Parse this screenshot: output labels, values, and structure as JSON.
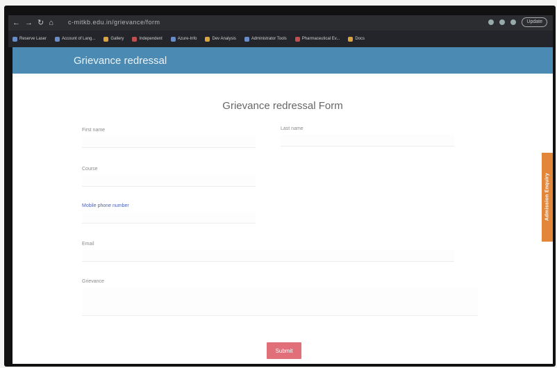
{
  "browser": {
    "url": "c-mitkb.edu.in/grievance/form",
    "profile_label": "Update",
    "bookmarks": [
      {
        "label": "Reserve Laser"
      },
      {
        "label": "Account of Lang..."
      },
      {
        "label": "Gallery"
      },
      {
        "label": "Independent"
      },
      {
        "label": "Azure-Info"
      },
      {
        "label": "Dev Analysis"
      },
      {
        "label": "Administrator Tools"
      },
      {
        "label": "Pharmaceutical Ev..."
      },
      {
        "label": "Docs"
      }
    ]
  },
  "header": {
    "title": "Grievance redressal"
  },
  "form": {
    "title": "Grievance redressal Form",
    "fields": {
      "first_name": "First name",
      "last_name": "Last name",
      "course": "Course",
      "mobile": "Mobile phone number",
      "email": "Email",
      "grievance": "Grievance"
    },
    "submit_label": "Submit"
  },
  "side_tab": {
    "label": "Admission Enquiry"
  },
  "colors": {
    "header": "#4b8bb3",
    "submit": "#e06f7a",
    "side_tab": "#e2873a"
  }
}
